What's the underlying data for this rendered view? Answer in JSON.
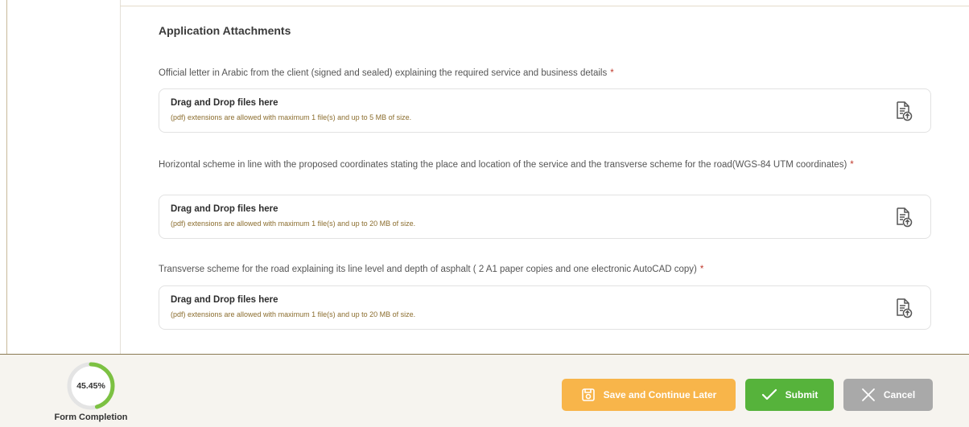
{
  "section": {
    "title": "Application Attachments"
  },
  "attachments": [
    {
      "label": "Official letter in Arabic from the client (signed and sealed) explaining the required service and business details",
      "required_mark": "*",
      "drop_title": "Drag and Drop files here",
      "drop_hint": "(pdf) extensions are allowed with maximum 1 file(s) and up to 5 MB of size.",
      "icon": "file-upload-icon"
    },
    {
      "label": "Horizontal scheme in line with the proposed coordinates stating the place and location of the service and the transverse scheme for the road(WGS-84 UTM coordinates)",
      "required_mark": "*",
      "drop_title": "Drag and Drop files here",
      "drop_hint": "(pdf) extensions are allowed with maximum 1 file(s) and up to 20 MB of size.",
      "icon": "file-upload-icon"
    },
    {
      "label": "Transverse scheme for the road explaining its line level and depth of asphalt ( 2 A1 paper copies and one electronic AutoCAD copy)",
      "required_mark": "*",
      "drop_title": "Drag and Drop files here",
      "drop_hint": "(pdf) extensions are allowed with maximum 1 file(s) and up to 20 MB of size.",
      "icon": "file-upload-icon"
    }
  ],
  "footer": {
    "progress_value": "45.45%",
    "progress_fraction": 0.4545,
    "progress_label": "Form Completion",
    "save_label": "Save and Continue Later",
    "submit_label": "Submit",
    "cancel_label": "Cancel"
  },
  "colors": {
    "progress": "#7cc142",
    "save": "#f8b54a",
    "submit": "#56b33b",
    "cancel": "#a9a9a9",
    "required": "#c0392b",
    "hint": "#8b6d2e"
  }
}
